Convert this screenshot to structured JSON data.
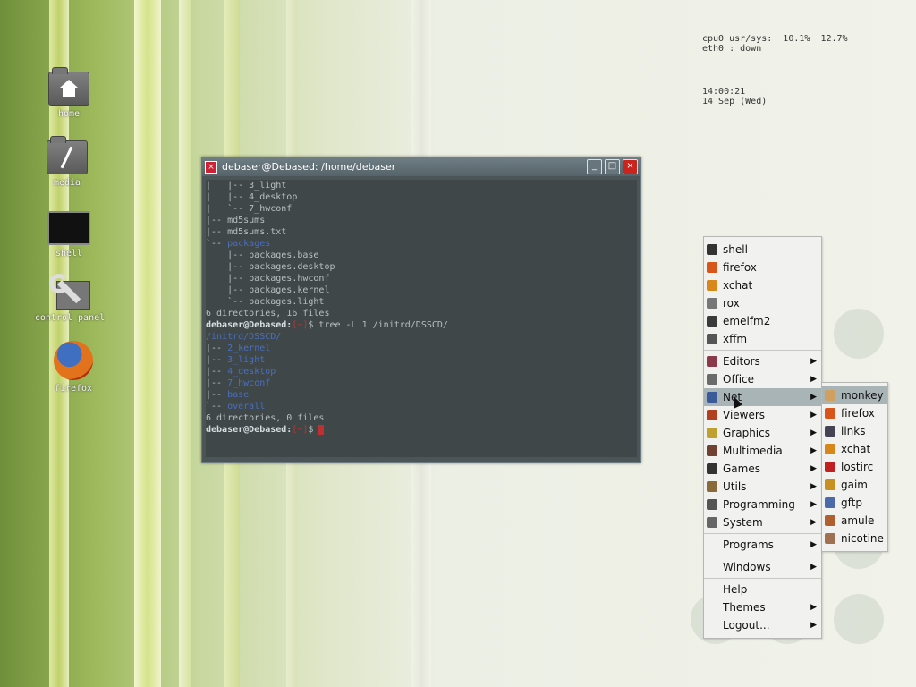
{
  "desktop": {
    "icons": [
      {
        "label": "home",
        "icon": "home-folder-icon"
      },
      {
        "label": "media",
        "icon": "media-folder-icon"
      },
      {
        "label": "shell",
        "icon": "terminal-icon"
      },
      {
        "label": "control panel",
        "icon": "wrench-icon"
      },
      {
        "label": "firefox",
        "icon": "firefox-icon"
      }
    ]
  },
  "sysmon": {
    "cpu_line": "cpu0 usr/sys:  10.1%  12.7%",
    "eth_line": "eth0 : down",
    "time": "14:00:21",
    "date": "14 Sep (Wed)"
  },
  "terminal": {
    "title": "debaser@Debased: /home/debaser",
    "lines": [
      {
        "t": "|   |-- 3_light",
        "c": ""
      },
      {
        "t": "|   |-- 4_desktop",
        "c": ""
      },
      {
        "t": "|   `-- 7_hwconf",
        "c": ""
      },
      {
        "t": "|-- md5sums",
        "c": ""
      },
      {
        "t": "|-- md5sums.txt",
        "c": ""
      },
      {
        "t": "`-- packages",
        "c": "blue-tail"
      },
      {
        "t": "    |-- packages.base",
        "c": ""
      },
      {
        "t": "    |-- packages.desktop",
        "c": ""
      },
      {
        "t": "    |-- packages.hwconf",
        "c": ""
      },
      {
        "t": "    |-- packages.kernel",
        "c": ""
      },
      {
        "t": "    `-- packages.light",
        "c": ""
      },
      {
        "t": "",
        "c": ""
      },
      {
        "t": "6 directories, 16 files",
        "c": ""
      },
      {
        "t": "debaser@Debased:[~]$ tree -L 1 /initrd/DSSCD/",
        "c": "prompt"
      },
      {
        "t": "/initrd/DSSCD/",
        "c": "blue"
      },
      {
        "t": "|-- 2_kernel",
        "c": "blue-tail"
      },
      {
        "t": "|-- 3_light",
        "c": "blue-tail"
      },
      {
        "t": "|-- 4_desktop",
        "c": "blue-tail"
      },
      {
        "t": "|-- 7_hwconf",
        "c": "blue-tail"
      },
      {
        "t": "|-- base",
        "c": "blue-tail"
      },
      {
        "t": "`-- overall",
        "c": "blue-tail"
      },
      {
        "t": "",
        "c": ""
      },
      {
        "t": "6 directories, 0 files",
        "c": ""
      },
      {
        "t": "debaser@Debased:[~]$ ",
        "c": "prompt-cursor"
      }
    ]
  },
  "main_menu": {
    "items": [
      {
        "label": "shell",
        "icon": "terminal-icon",
        "color": "#333",
        "arrow": false
      },
      {
        "label": "firefox",
        "icon": "firefox-icon",
        "color": "#d9541a",
        "arrow": false
      },
      {
        "label": "xchat",
        "icon": "xchat-icon",
        "color": "#d8871a",
        "arrow": false
      },
      {
        "label": "rox",
        "icon": "rox-icon",
        "color": "#777",
        "arrow": false
      },
      {
        "label": "emelfm2",
        "icon": "emelfm2-icon",
        "color": "#3a3a3a",
        "arrow": false
      },
      {
        "label": "xffm",
        "icon": "xffm-icon",
        "color": "#555",
        "arrow": false
      },
      {
        "sep": true
      },
      {
        "label": "Editors",
        "icon": "editors-icon",
        "color": "#8a3a4a",
        "arrow": true
      },
      {
        "label": "Office",
        "icon": "office-icon",
        "color": "#6a6a6a",
        "arrow": true
      },
      {
        "label": "Net",
        "icon": "net-icon",
        "color": "#3a5a9a",
        "arrow": true,
        "selected": true
      },
      {
        "label": "Viewers",
        "icon": "viewers-icon",
        "color": "#b04020",
        "arrow": true
      },
      {
        "label": "Graphics",
        "icon": "graphics-icon",
        "color": "#c0a030",
        "arrow": true
      },
      {
        "label": "Multimedia",
        "icon": "multimedia-icon",
        "color": "#704030",
        "arrow": true
      },
      {
        "label": "Games",
        "icon": "games-icon",
        "color": "#333",
        "arrow": true
      },
      {
        "label": "Utils",
        "icon": "utils-icon",
        "color": "#8a6a3a",
        "arrow": true
      },
      {
        "label": "Programming",
        "icon": "programming-icon",
        "color": "#555",
        "arrow": true
      },
      {
        "label": "System",
        "icon": "system-icon",
        "color": "#666",
        "arrow": true
      },
      {
        "sep": true
      },
      {
        "label": "Programs",
        "icon": "",
        "color": "",
        "arrow": true
      },
      {
        "sep": true
      },
      {
        "label": "Windows",
        "icon": "",
        "color": "",
        "arrow": true
      },
      {
        "sep": true
      },
      {
        "label": "Help",
        "icon": "",
        "color": "",
        "arrow": false
      },
      {
        "label": "Themes",
        "icon": "",
        "color": "",
        "arrow": true
      },
      {
        "label": "Logout...",
        "icon": "",
        "color": "",
        "arrow": true
      }
    ]
  },
  "net_menu": {
    "items": [
      {
        "label": "monkey",
        "icon": "monkey-icon",
        "color": "#d0a060",
        "selected": true
      },
      {
        "label": "firefox",
        "icon": "firefox-icon",
        "color": "#d9541a"
      },
      {
        "label": "links",
        "icon": "links-icon",
        "color": "#445"
      },
      {
        "label": "xchat",
        "icon": "xchat-icon",
        "color": "#d8871a"
      },
      {
        "label": "lostirc",
        "icon": "lostirc-icon",
        "color": "#c02020"
      },
      {
        "label": "gaim",
        "icon": "gaim-icon",
        "color": "#c89020"
      },
      {
        "label": "gftp",
        "icon": "gftp-icon",
        "color": "#4a6aaa"
      },
      {
        "label": "amule",
        "icon": "amule-icon",
        "color": "#b06030"
      },
      {
        "label": "nicotine",
        "icon": "nicotine-icon",
        "color": "#a07050"
      }
    ]
  }
}
